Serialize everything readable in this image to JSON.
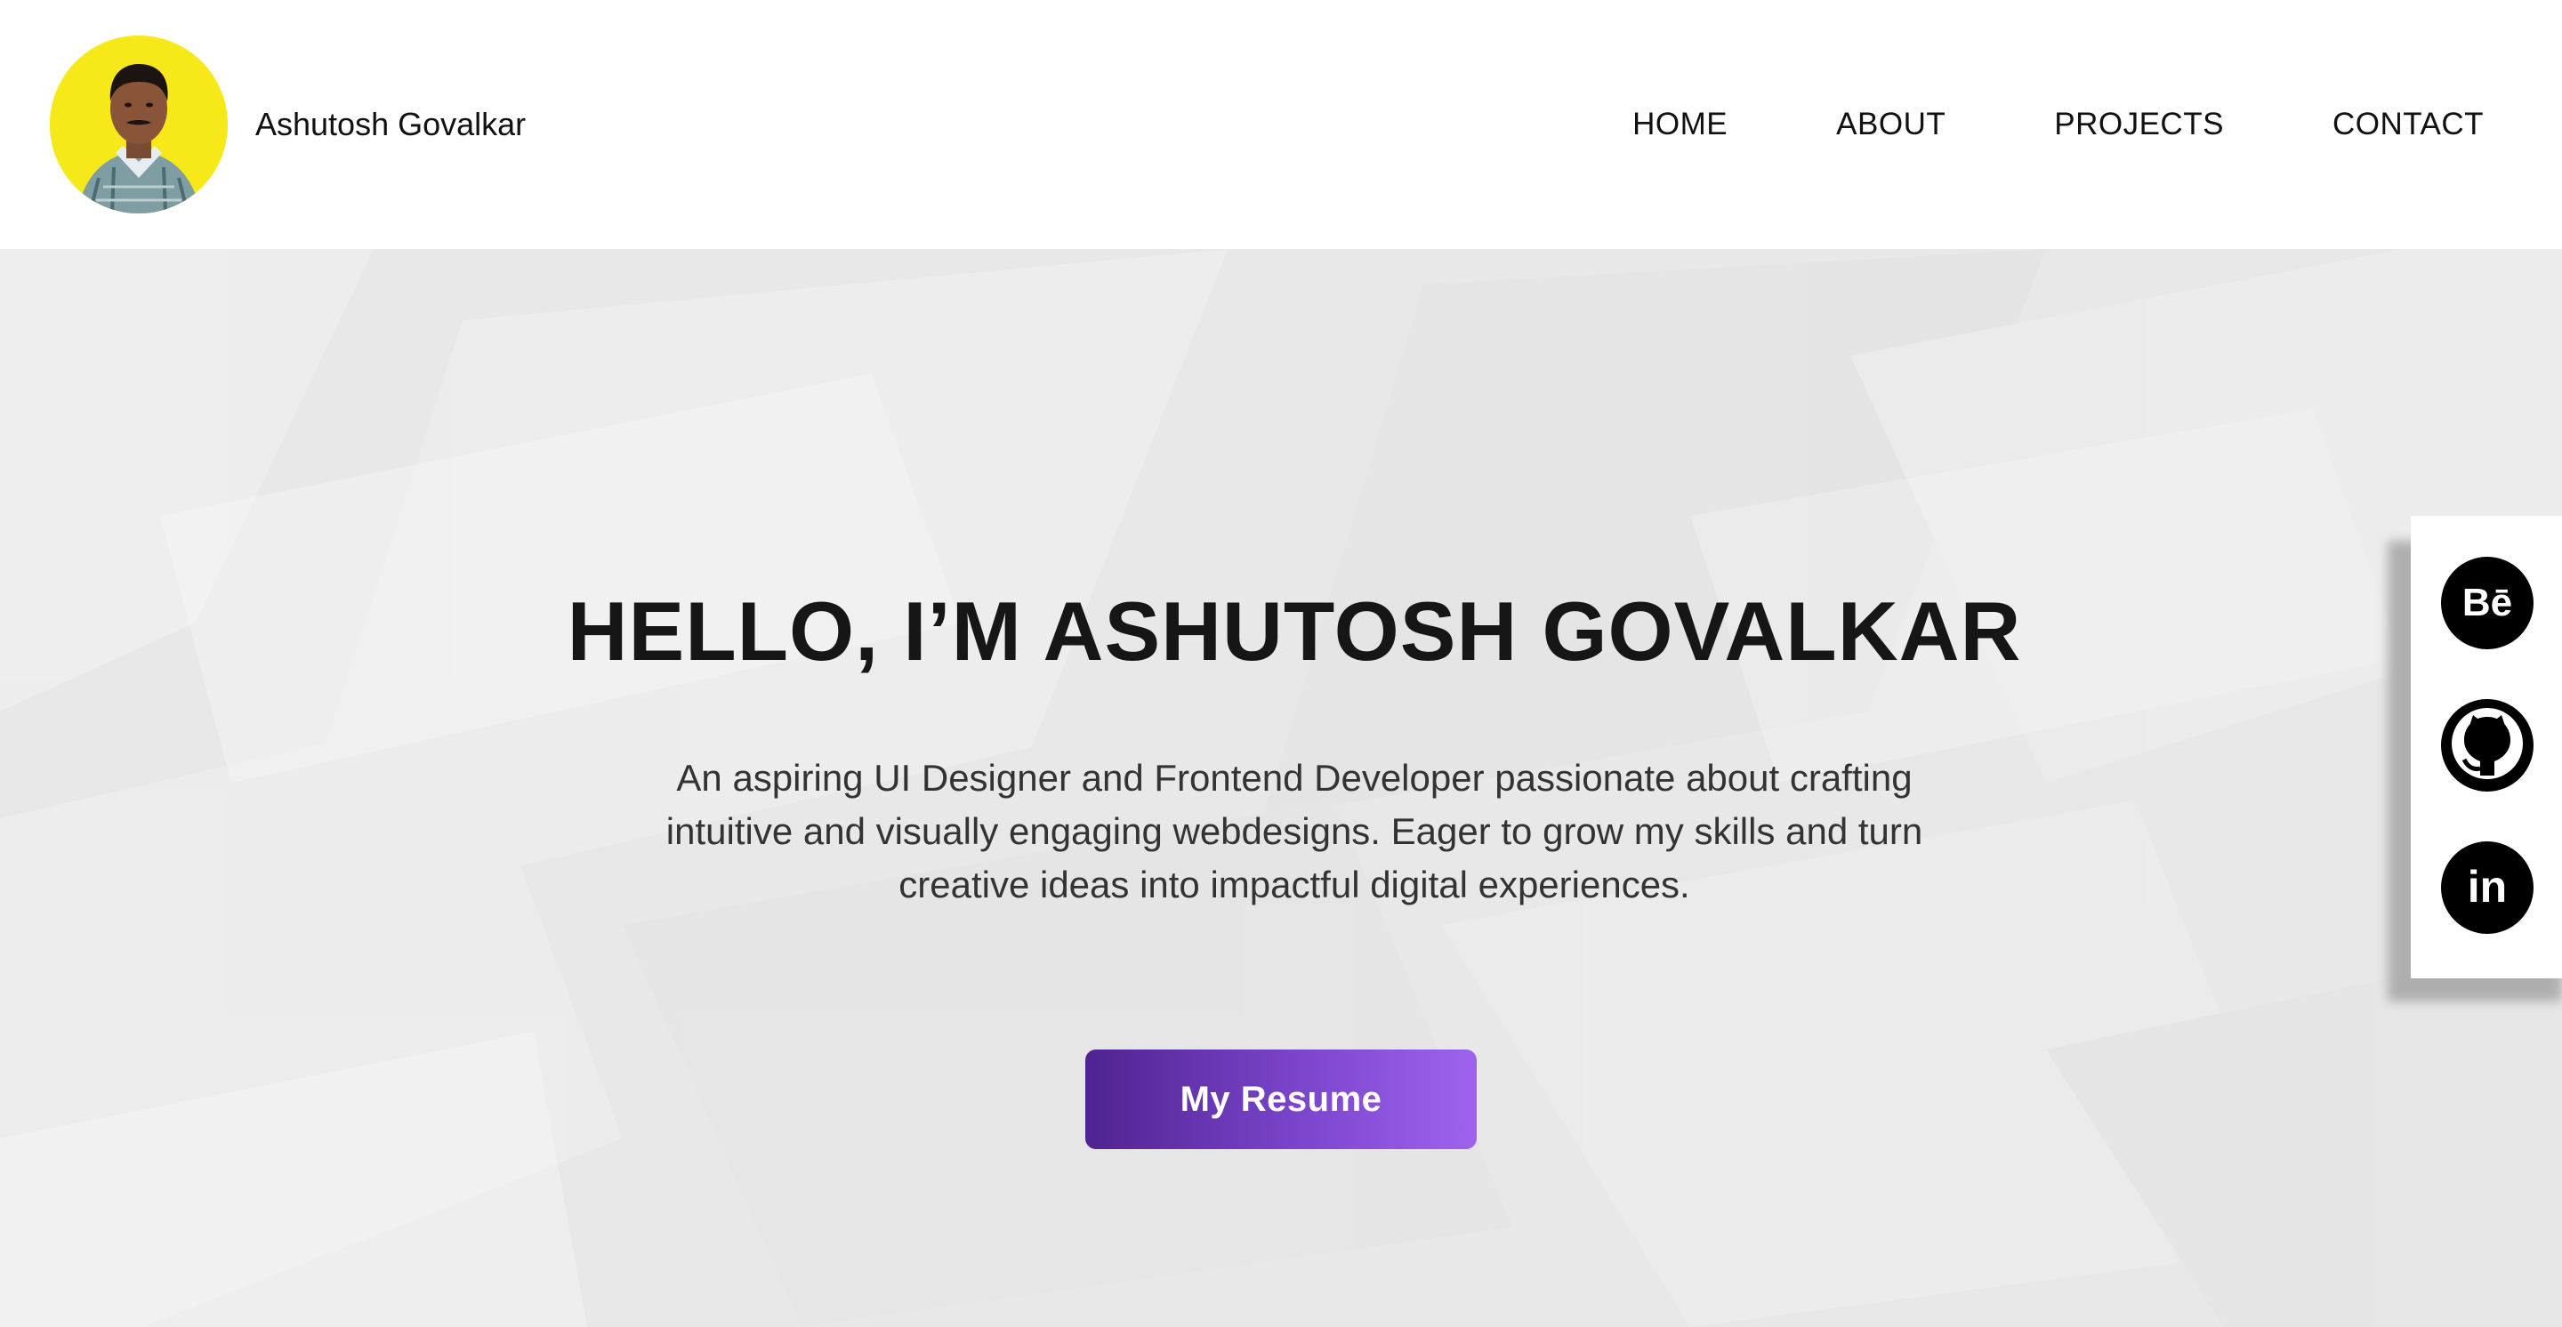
{
  "header": {
    "name": "Ashutosh Govalkar",
    "nav": [
      {
        "label": "HOME"
      },
      {
        "label": "ABOUT"
      },
      {
        "label": "PROJECTS"
      },
      {
        "label": "CONTACT"
      }
    ]
  },
  "hero": {
    "title": "HELLO, I’M ASHUTOSH GOVALKAR",
    "description": "An aspiring UI Designer and Frontend Developer passionate about crafting intuitive and visually engaging webdesigns. Eager to grow my skills and turn creative ideas into impactful digital experiences.",
    "button_label": "My Resume"
  },
  "social": [
    {
      "icon": "behance-icon"
    },
    {
      "icon": "github-icon"
    },
    {
      "icon": "linkedin-icon"
    }
  ],
  "colors": {
    "avatar_bg": "#f7e81a",
    "hero_bg": "#e9e9e9",
    "button_gradient_start": "#4f2390",
    "button_gradient_end": "#9f63ee",
    "text_dark": "#161616"
  }
}
